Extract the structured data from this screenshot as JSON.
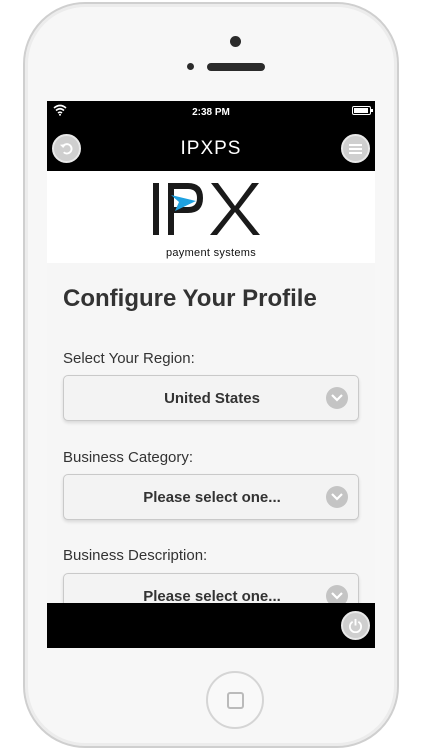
{
  "status_bar": {
    "time": "2:38 PM"
  },
  "nav": {
    "title": "IPXPS"
  },
  "logo": {
    "wordmark": "IPX",
    "subtitle": "payment systems"
  },
  "form": {
    "heading": "Configure Your Profile",
    "region": {
      "label": "Select Your Region:",
      "value": "United States"
    },
    "category": {
      "label": "Business Category:",
      "value": "Please select one..."
    },
    "description": {
      "label": "Business Description:",
      "value": "Please select one..."
    }
  },
  "colors": {
    "accent": "#1ea1e0",
    "bar": "#000000"
  }
}
